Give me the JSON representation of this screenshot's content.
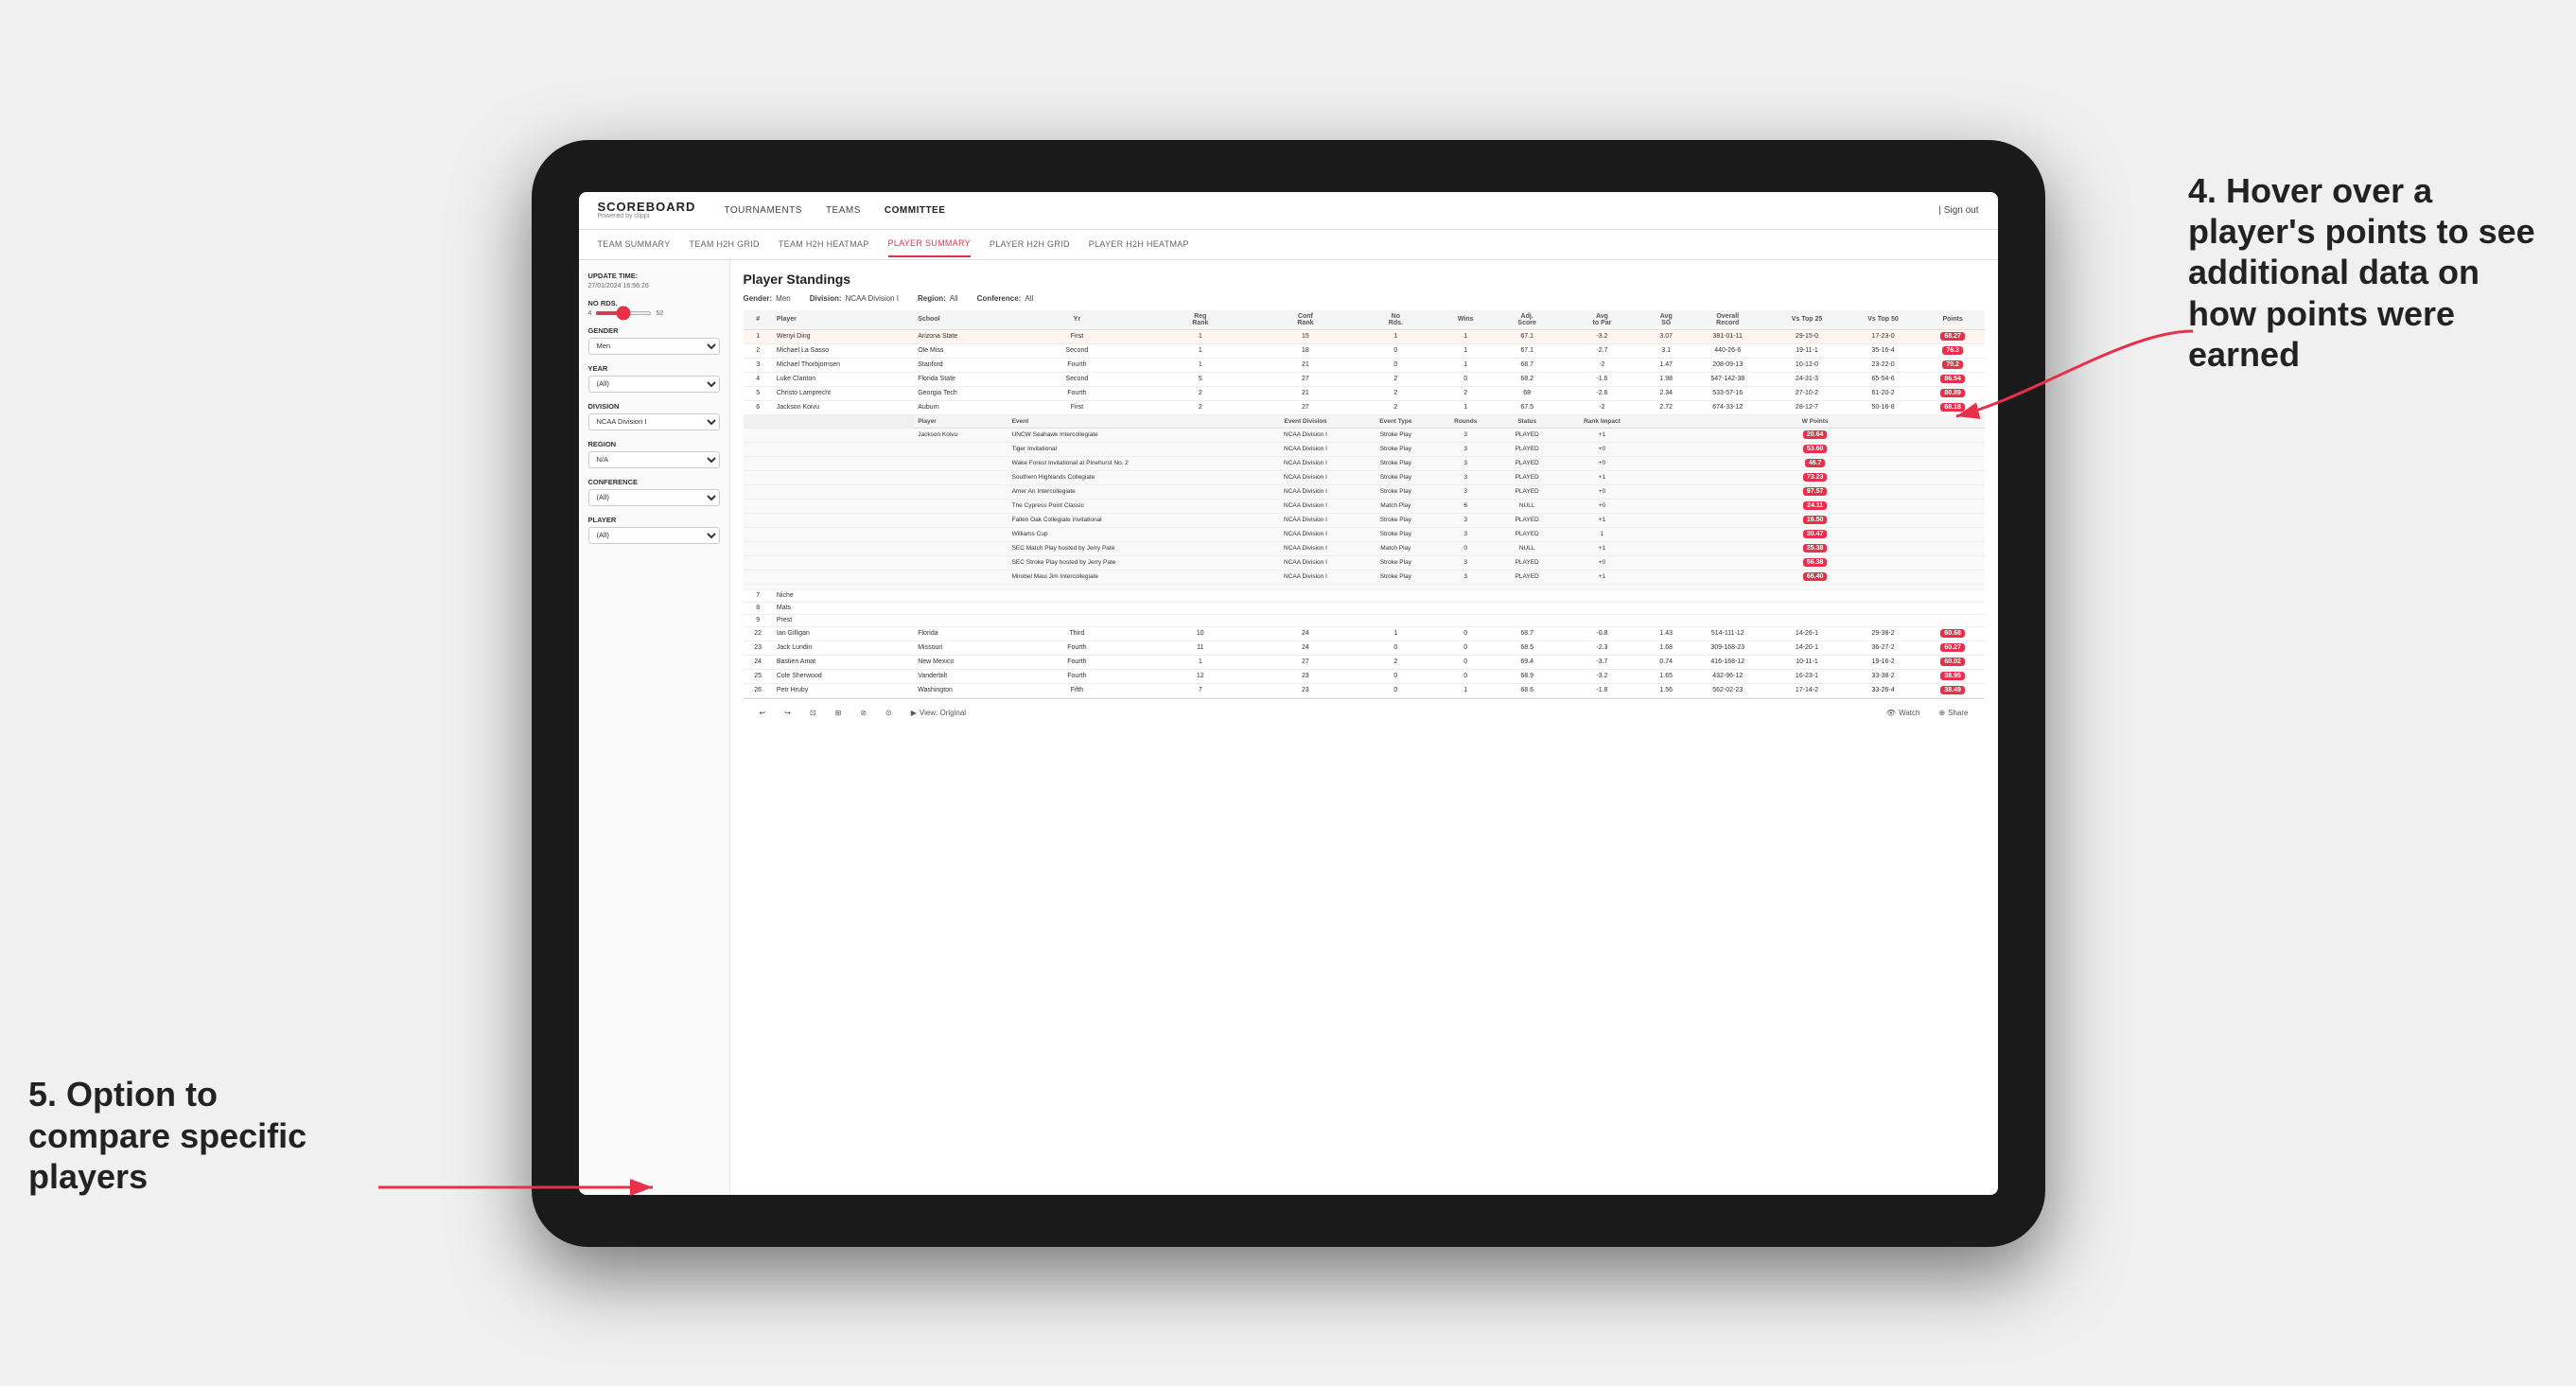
{
  "page": {
    "background": "#f0f0f0"
  },
  "nav": {
    "logo": "SCOREBOARD",
    "logo_sub": "Powered by clippi",
    "items": [
      "TOURNAMENTS",
      "TEAMS",
      "COMMITTEE"
    ],
    "sign_out": "Sign out",
    "active_nav": "COMMITTEE"
  },
  "sub_nav": {
    "items": [
      "TEAM SUMMARY",
      "TEAM H2H GRID",
      "TEAM H2H HEATMAP",
      "PLAYER SUMMARY",
      "PLAYER H2H GRID",
      "PLAYER H2H HEATMAP"
    ],
    "active": "PLAYER SUMMARY"
  },
  "sidebar": {
    "update_time_label": "Update time:",
    "update_time": "27/01/2024 16:56:26",
    "no_rds_label": "No Rds.",
    "no_rds_min": "4",
    "no_rds_max": "52",
    "gender_label": "Gender",
    "gender_value": "Men",
    "year_label": "Year",
    "year_value": "(All)",
    "division_label": "Division",
    "division_value": "NCAA Division I",
    "region_label": "Region",
    "region_value": "N/A",
    "conference_label": "Conference",
    "conference_value": "(All)",
    "player_label": "Player",
    "player_value": "(All)"
  },
  "content": {
    "title": "Player Standings",
    "filters": {
      "gender": "Men",
      "division": "NCAA Division I",
      "region": "All",
      "conference": "All"
    },
    "table_headers": [
      "#",
      "Player",
      "School",
      "Yr",
      "Reg Rank",
      "Conf Rank",
      "No Rds.",
      "Wins",
      "Adj. Score",
      "Avg to Par",
      "Avg SG",
      "Overall Record",
      "Vs Top 25",
      "Vs Top 50",
      "Points"
    ],
    "players": [
      {
        "rank": 1,
        "name": "Wenyi Ding",
        "school": "Arizona State",
        "yr": "First",
        "reg_rank": 1,
        "conf_rank": 15,
        "rds": 1,
        "wins": 1,
        "adj_score": 67.1,
        "to_par": -3.2,
        "sg": 3.07,
        "record": "381-01-11",
        "vs25": "29-15-0",
        "vs50": "17-23-0",
        "points": "68.27",
        "highlight": true
      },
      {
        "rank": 2,
        "name": "Michael La Sasso",
        "school": "Ole Miss",
        "yr": "Second",
        "reg_rank": 1,
        "conf_rank": 18,
        "rds": 0,
        "wins": 1,
        "adj_score": 67.1,
        "to_par": -2.7,
        "sg": 3.1,
        "record": "440-26-6",
        "vs25": "19-11-1",
        "vs50": "35-16-4",
        "points": "76.3"
      },
      {
        "rank": 3,
        "name": "Michael Thorbjornsen",
        "school": "Stanford",
        "yr": "Fourth",
        "reg_rank": 1,
        "conf_rank": 21,
        "rds": 0,
        "wins": 1,
        "adj_score": 68.7,
        "to_par": -2.0,
        "sg": 1.47,
        "record": "208-09-13",
        "vs25": "10-12-0",
        "vs50": "23-22-0",
        "points": "70.2"
      },
      {
        "rank": 4,
        "name": "Luke Clanton",
        "school": "Florida State",
        "yr": "Second",
        "reg_rank": 5,
        "conf_rank": 27,
        "rds": 2,
        "wins": 0,
        "adj_score": 68.2,
        "to_par": -1.6,
        "sg": 1.98,
        "record": "547-142-38",
        "vs25": "24-31-3",
        "vs50": "65-54-6",
        "points": "86.54"
      },
      {
        "rank": 5,
        "name": "Christo Lamprecht",
        "school": "Georgia Tech",
        "yr": "Fourth",
        "reg_rank": 2,
        "conf_rank": 21,
        "rds": 2,
        "wins": 2,
        "adj_score": 68.0,
        "to_par": -2.6,
        "sg": 2.34,
        "record": "533-57-16",
        "vs25": "27-10-2",
        "vs50": "61-20-2",
        "points": "80.89"
      },
      {
        "rank": 6,
        "name": "Jackson Koivu",
        "school": "Auburn",
        "yr": "First",
        "reg_rank": 2,
        "conf_rank": 27,
        "rds": 2,
        "wins": 1,
        "adj_score": 67.5,
        "to_par": -2.0,
        "sg": 2.72,
        "record": "674-33-12",
        "vs25": "28-12-7",
        "vs50": "50-16-8",
        "points": "68.18"
      },
      {
        "rank": 7,
        "name": "Niche",
        "school": "",
        "yr": "",
        "reg_rank": null,
        "conf_rank": null,
        "rds": null,
        "wins": null,
        "adj_score": null,
        "to_par": null,
        "sg": null,
        "record": "",
        "vs25": "",
        "vs50": "",
        "points": ""
      },
      {
        "rank": 8,
        "name": "Mats",
        "school": "",
        "yr": "",
        "reg_rank": null,
        "conf_rank": null,
        "rds": null,
        "wins": null,
        "adj_score": null,
        "to_par": null,
        "sg": null,
        "record": "",
        "vs25": "",
        "vs50": "",
        "points": ""
      },
      {
        "rank": 9,
        "name": "Prest",
        "school": "",
        "yr": "",
        "reg_rank": null,
        "conf_rank": null,
        "rds": null,
        "wins": null,
        "adj_score": null,
        "to_par": null,
        "sg": null,
        "record": "",
        "vs25": "",
        "vs50": "",
        "points": ""
      }
    ],
    "expanded_player": "Jackson Koivu",
    "expanded_headers": [
      "Player",
      "Event",
      "Event Division",
      "Event Type",
      "Rounds",
      "Status",
      "Rank Impact",
      "W Points"
    ],
    "expanded_rows": [
      {
        "player": "Jackson Koivu",
        "event": "UNCW Seahawk Intercollegiate",
        "division": "NCAA Division I",
        "type": "Stroke Play",
        "rounds": 3,
        "status": "PLAYED",
        "rank_impact": "+1",
        "points": "20.64"
      },
      {
        "player": "",
        "event": "Tiger Invitational",
        "division": "NCAA Division I",
        "type": "Stroke Play",
        "rounds": 3,
        "status": "PLAYED",
        "rank_impact": "+0",
        "points": "53.60"
      },
      {
        "player": "",
        "event": "Wake Forest Invitational at Pinehurst No. 2",
        "division": "NCAA Division I",
        "type": "Stroke Play",
        "rounds": 3,
        "status": "PLAYED",
        "rank_impact": "+0",
        "points": "46.7"
      },
      {
        "player": "",
        "event": "Southern Highlands Collegiate",
        "division": "NCAA Division I",
        "type": "Stroke Play",
        "rounds": 3,
        "status": "PLAYED",
        "rank_impact": "+1",
        "points": "73.23"
      },
      {
        "player": "",
        "event": "Amer An Intercollegiate",
        "division": "NCAA Division I",
        "type": "Stroke Play",
        "rounds": 3,
        "status": "PLAYED",
        "rank_impact": "+0",
        "points": "97.57"
      },
      {
        "player": "",
        "event": "The Cypress Point Classic",
        "division": "NCAA Division I",
        "type": "Match Play",
        "rounds": 6,
        "status": "NULL",
        "rank_impact": "+0",
        "points": "24.11"
      },
      {
        "player": "",
        "event": "Fallen Oak Collegiate Invitational",
        "division": "NCAA Division I",
        "type": "Stroke Play",
        "rounds": 3,
        "status": "PLAYED",
        "rank_impact": "+1",
        "points": "16.50"
      },
      {
        "player": "",
        "event": "Williams Cup",
        "division": "NCAA Division I",
        "type": "Stroke Play",
        "rounds": 3,
        "status": "PLAYED",
        "rank_impact": "1",
        "points": "30.47"
      },
      {
        "player": "",
        "event": "SEC Match Play hosted by Jerry Pate",
        "division": "NCAA Division I",
        "type": "Match Play",
        "rounds": 0,
        "status": "NULL",
        "rank_impact": "+1",
        "points": "25.38"
      },
      {
        "player": "",
        "event": "SEC Stroke Play hosted by Jerry Pate",
        "division": "NCAA Division I",
        "type": "Stroke Play",
        "rounds": 3,
        "status": "PLAYED",
        "rank_impact": "+0",
        "points": "56.38"
      },
      {
        "player": "",
        "event": "Mirobel Maui Jim Intercollegiate",
        "division": "NCAA Division I",
        "type": "Stroke Play",
        "rounds": 3,
        "status": "PLAYED",
        "rank_impact": "+1",
        "points": "66.40"
      },
      {
        "player": "",
        "event": "",
        "division": "",
        "type": "",
        "rounds": null,
        "status": "",
        "rank_impact": "",
        "points": ""
      }
    ],
    "more_players": [
      {
        "rank": 22,
        "name": "Ian Gilligan",
        "school": "Florida",
        "yr": "Third",
        "reg_rank": 10,
        "conf_rank": 24,
        "rds": 1,
        "wins": 0,
        "adj_score": 68.7,
        "to_par": -0.8,
        "sg": 1.43,
        "record": "514-111-12",
        "vs25": "14-26-1",
        "vs50": "29-38-2",
        "points": "60.68"
      },
      {
        "rank": 23,
        "name": "Jack Lundin",
        "school": "Missouri",
        "yr": "Fourth",
        "reg_rank": 11,
        "conf_rank": 24,
        "rds": 0,
        "wins": 0,
        "adj_score": 68.5,
        "to_par": -2.3,
        "sg": 1.68,
        "record": "309-168-23",
        "vs25": "14-20-1",
        "vs50": "36-27-2",
        "points": "60.27"
      },
      {
        "rank": 24,
        "name": "Bastien Amat",
        "school": "New Mexico",
        "yr": "Fourth",
        "reg_rank": 1,
        "conf_rank": 27,
        "rds": 2,
        "wins": 0,
        "adj_score": 69.4,
        "to_par": -3.7,
        "sg": 0.74,
        "record": "416-168-12",
        "vs25": "10-11-1",
        "vs50": "19-16-2",
        "points": "60.02"
      },
      {
        "rank": 25,
        "name": "Cole Sherwood",
        "school": "Vanderbilt",
        "yr": "Fourth",
        "reg_rank": 12,
        "conf_rank": 23,
        "rds": 0,
        "wins": 0,
        "adj_score": 68.9,
        "to_par": -3.2,
        "sg": 1.65,
        "record": "432-96-12",
        "vs25": "16-23-1",
        "vs50": "33-38-2",
        "points": "38.95"
      },
      {
        "rank": 26,
        "name": "Petr Hruby",
        "school": "Washington",
        "yr": "Fifth",
        "reg_rank": 7,
        "conf_rank": 23,
        "rds": 0,
        "wins": 1,
        "adj_score": 68.6,
        "to_par": -1.8,
        "sg": 1.56,
        "record": "562-02-23",
        "vs25": "17-14-2",
        "vs50": "33-26-4",
        "points": "38.49"
      }
    ]
  },
  "toolbar": {
    "undo": "↩",
    "redo": "↪",
    "view_original": "View: Original",
    "watch": "Watch",
    "share": "Share"
  },
  "annotations": {
    "annotation4_title": "4. Hover over a player's points to see additional data on how points were earned",
    "annotation5_title": "5. Option to compare specific players"
  }
}
